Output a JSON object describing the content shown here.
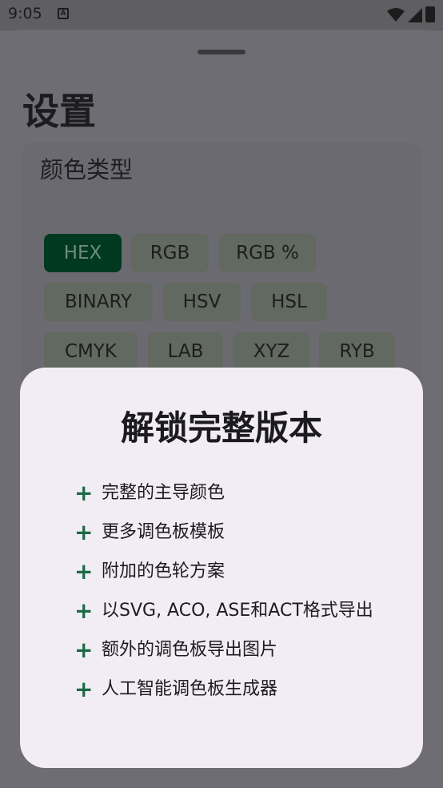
{
  "status": {
    "time": "9:05"
  },
  "sheet": {
    "title": "设置",
    "color_type": {
      "label": "颜色类型",
      "options": [
        "HEX",
        "RGB",
        "RGB %",
        "BINARY",
        "HSV",
        "HSL",
        "CMYK",
        "LAB",
        "XYZ",
        "RYB"
      ],
      "selected": "HEX"
    }
  },
  "dialog": {
    "title": "解锁完整版本",
    "features": [
      "完整的主导颜色",
      "更多调色板模板",
      "附加的色轮方案",
      "以SVG, ACO, ASE和ACT格式导出",
      "额外的调色板导出图片",
      "人工智能调色板生成器"
    ]
  },
  "colors": {
    "accent": "#1b6b45",
    "selected_chip": "#00391f",
    "dialog_bg": "#f2edf4"
  }
}
